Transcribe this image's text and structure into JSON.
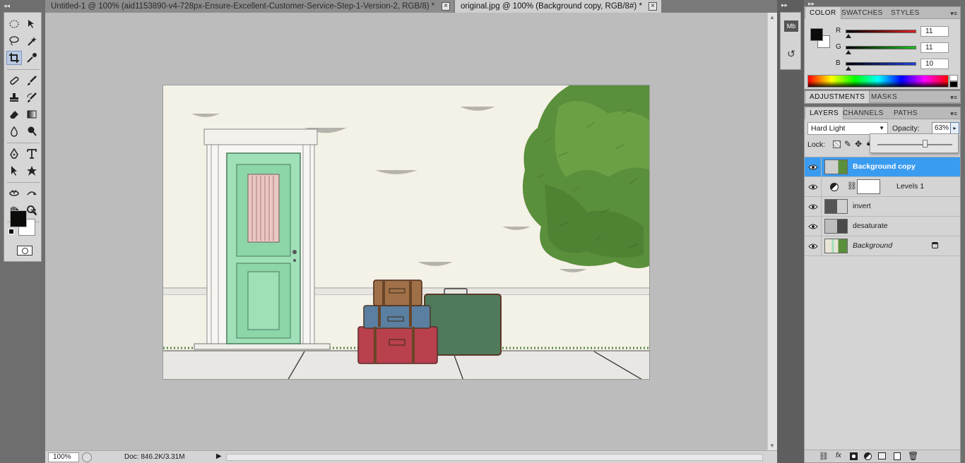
{
  "tabs": [
    {
      "label": "Untitled-1 @ 100% (aid1153890-v4-728px-Ensure-Excellent-Customer-Service-Step-1-Version-2, RGB/8) *",
      "active": false
    },
    {
      "label": "original.jpg @ 100% (Background copy, RGB/8#) *",
      "active": true
    }
  ],
  "status": {
    "zoom": "100%",
    "doc_info": "Doc: 846.2K/3.31M"
  },
  "color_panel": {
    "tabs": [
      "COLOR",
      "SWATCHES",
      "STYLES"
    ],
    "channels": [
      {
        "label": "R",
        "value": "11",
        "color": "#e02020"
      },
      {
        "label": "G",
        "value": "11",
        "color": "#20c020"
      },
      {
        "label": "B",
        "value": "10",
        "color": "#2040e0"
      }
    ]
  },
  "adjustments_panel": {
    "tabs": [
      "ADJUSTMENTS",
      "MASKS"
    ]
  },
  "layers_panel": {
    "tabs": [
      "LAYERS",
      "CHANNELS",
      "PATHS"
    ],
    "blend_mode": "Hard Light",
    "opacity_label": "Opacity:",
    "opacity_value": "63%",
    "lock_label": "Lock:",
    "layers": [
      {
        "name": "Background copy",
        "selected": true
      },
      {
        "name": "Levels 1",
        "selected": false
      },
      {
        "name": "invert",
        "selected": false
      },
      {
        "name": "desaturate",
        "selected": false
      },
      {
        "name": "Background",
        "selected": false
      }
    ]
  },
  "minidock": {
    "mb_label": "Mb"
  },
  "colors": {
    "selection": "#3a9cf0",
    "canvas_bg": "#bcbcbc",
    "panel_bg": "#d4d4d4"
  }
}
